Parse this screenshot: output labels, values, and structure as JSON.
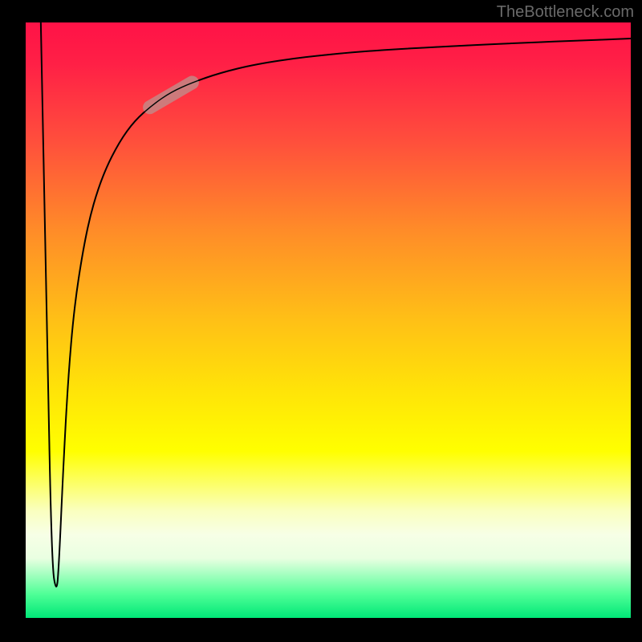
{
  "watermark": "TheBottleneck.com",
  "chart_data": {
    "type": "line",
    "title": "",
    "xlabel": "",
    "ylabel": "",
    "xlim": [
      0,
      100
    ],
    "ylim": [
      0,
      100
    ],
    "grid": false,
    "legend": false,
    "background_gradient": {
      "stops": [
        {
          "offset": 0.0,
          "color": "#ff1247"
        },
        {
          "offset": 0.07,
          "color": "#ff2046"
        },
        {
          "offset": 0.2,
          "color": "#ff4f3c"
        },
        {
          "offset": 0.35,
          "color": "#ff8c28"
        },
        {
          "offset": 0.5,
          "color": "#ffc016"
        },
        {
          "offset": 0.62,
          "color": "#ffe408"
        },
        {
          "offset": 0.72,
          "color": "#ffff00"
        },
        {
          "offset": 0.82,
          "color": "#faffbf"
        },
        {
          "offset": 0.86,
          "color": "#f7ffe6"
        },
        {
          "offset": 0.9,
          "color": "#e9ffe1"
        },
        {
          "offset": 0.96,
          "color": "#4fff97"
        },
        {
          "offset": 1.0,
          "color": "#00e777"
        }
      ]
    },
    "band_highlight": {
      "x_start": 20.5,
      "x_end": 27.5,
      "color": "#c38a88",
      "opacity": 0.82
    },
    "series": [
      {
        "name": "curve",
        "color": "#000000",
        "stroke_width": 2,
        "x": [
          2.5,
          3.5,
          4.3,
          5.1,
          5.5,
          6.2,
          7.0,
          8.0,
          9.5,
          11.0,
          13.0,
          15.5,
          18.0,
          21.0,
          24.0,
          27.5,
          32.0,
          38.0,
          46.0,
          55.0,
          66.0,
          80.0,
          100.0
        ],
        "values": [
          100,
          50,
          9,
          4,
          9,
          25,
          40,
          52,
          62,
          69,
          75,
          80,
          83.5,
          86.2,
          88.3,
          89.9,
          91.5,
          93.0,
          94.2,
          95.1,
          95.8,
          96.5,
          97.3
        ]
      }
    ]
  }
}
